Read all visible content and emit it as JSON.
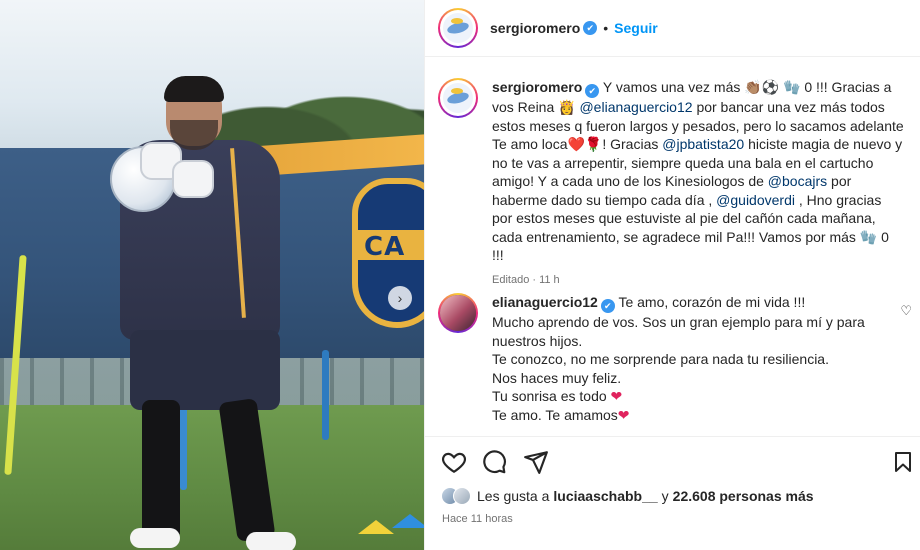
{
  "post": {
    "username": "sergioromero",
    "verified": "✔",
    "dot": "•",
    "follow_label": "Seguir"
  },
  "caption": {
    "username": "sergioromero",
    "text_1": "Y vamos una vez más 👏🏽⚽ 🧤 0 !!! Gracias a vos Reina 👸",
    "mention_1": "@elianaguercio12",
    "text_2": "por bancar una vez más todos estos meses q fueron largos y pesados, pero lo sacamos adelante Te amo loca❤️🌹! Gracias",
    "mention_2": "@jpbatista20",
    "text_3": "hiciste magia de nuevo y no te vas a arrepentir, siempre queda una bala en el cartucho amigo! Y a cada uno de los Kinesiologos de",
    "mention_3": "@bocajrs",
    "text_4": "por haberme dado su tiempo cada día ,",
    "mention_4": "@guidoverdi",
    "text_5": ", Hno gracias por estos meses que estuviste al pie del cañón cada mañana, cada entrenamiento, se agradece mil Pa!!! Vamos por más 🧤 0 !!!",
    "meta": "Editado · 11 h"
  },
  "comment": {
    "username": "elianaguercio12",
    "line_1": "Te amo, corazón de mi vida !!!",
    "line_2": "Mucho aprendo de vos. Sos un gran ejemplo para mí y para nuestros hijos.",
    "line_3": "Te conozco, no me sorprende para nada tu resiliencia.",
    "line_4": "Nos haces muy feliz.",
    "line_5": "Tu sonrisa es todo",
    "line_6": "Te amo. Te amamos",
    "heart": "❤",
    "like_icon": "♡"
  },
  "photo": {
    "crest_text": "CA",
    "next_arrow": "›"
  },
  "footer": {
    "likes_prefix": "Les gusta a",
    "likes_user": "luciaaschabb__",
    "likes_and": "y",
    "likes_count": "22.608 personas más",
    "ago": "Hace 11 horas"
  },
  "colors": {
    "accent": "#0095f6",
    "verified": "#3897f0",
    "heart": "#e0245e",
    "mention": "#00376b"
  },
  "icons": {
    "like": "heart-icon",
    "comment": "comment-icon",
    "share": "share-icon",
    "save": "bookmark-icon",
    "verified": "verified-badge-icon"
  }
}
